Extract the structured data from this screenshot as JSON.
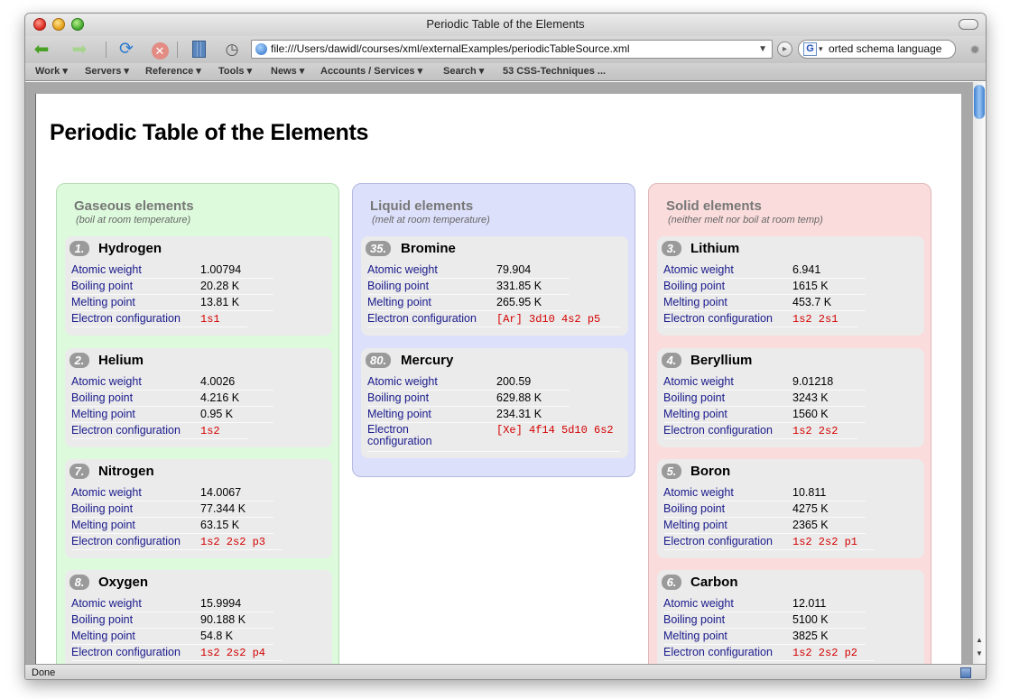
{
  "window": {
    "title": "Periodic Table of the Elements"
  },
  "toolbar": {
    "url": "file:///Users/dawidl/courses/xml/externalExamples/periodicTableSource.xml",
    "search_value": "orted schema language"
  },
  "bookmarks": [
    "Work ▾",
    "Servers ▾",
    "Reference ▾",
    "Tools ▾",
    "News ▾",
    "Accounts / Services ▾",
    "Search ▾",
    "53 CSS-Techniques ..."
  ],
  "status": "Done",
  "labels": {
    "atomic_weight": "Atomic weight",
    "boiling_point": "Boiling point",
    "melting_point": "Melting point",
    "electron_configuration": "Electron configuration"
  },
  "page": {
    "title": "Periodic Table of the Elements",
    "columns": [
      {
        "heading": "Gaseous elements",
        "subheading": "(boil at room temperature)",
        "elements": [
          {
            "number": "1.",
            "name": "Hydrogen",
            "atomic_weight": "1.00794",
            "boiling_point": "20.28 K",
            "melting_point": "13.81 K",
            "electron_configuration": "1s1"
          },
          {
            "number": "2.",
            "name": "Helium",
            "atomic_weight": "4.0026",
            "boiling_point": "4.216 K",
            "melting_point": "0.95 K",
            "electron_configuration": "1s2"
          },
          {
            "number": "7.",
            "name": "Nitrogen",
            "atomic_weight": "14.0067",
            "boiling_point": "77.344 K",
            "melting_point": "63.15 K",
            "electron_configuration": "1s2 2s2 p3"
          },
          {
            "number": "8.",
            "name": "Oxygen",
            "atomic_weight": "15.9994",
            "boiling_point": "90.188 K",
            "melting_point": "54.8 K",
            "electron_configuration": "1s2 2s2 p4"
          }
        ]
      },
      {
        "heading": "Liquid elements",
        "subheading": "(melt at room temperature)",
        "elements": [
          {
            "number": "35.",
            "name": "Bromine",
            "atomic_weight": "79.904",
            "boiling_point": "331.85 K",
            "melting_point": "265.95 K",
            "electron_configuration": "[Ar] 3d10 4s2 p5"
          },
          {
            "number": "80.",
            "name": "Mercury",
            "atomic_weight": "200.59",
            "boiling_point": "629.88 K",
            "melting_point": "234.31 K",
            "electron_configuration": "[Xe] 4f14 5d10 6s2"
          }
        ]
      },
      {
        "heading": "Solid elements",
        "subheading": "(neither melt nor boil at room temp)",
        "elements": [
          {
            "number": "3.",
            "name": "Lithium",
            "atomic_weight": "6.941",
            "boiling_point": "1615 K",
            "melting_point": "453.7 K",
            "electron_configuration": "1s2 2s1"
          },
          {
            "number": "4.",
            "name": "Beryllium",
            "atomic_weight": "9.01218",
            "boiling_point": "3243 K",
            "melting_point": "1560 K",
            "electron_configuration": "1s2 2s2"
          },
          {
            "number": "5.",
            "name": "Boron",
            "atomic_weight": "10.811",
            "boiling_point": "4275 K",
            "melting_point": "2365 K",
            "electron_configuration": "1s2 2s2 p1"
          },
          {
            "number": "6.",
            "name": "Carbon",
            "atomic_weight": "12.011",
            "boiling_point": "5100 K",
            "melting_point": "3825 K",
            "electron_configuration": "1s2 2s2 p2"
          }
        ]
      }
    ]
  }
}
